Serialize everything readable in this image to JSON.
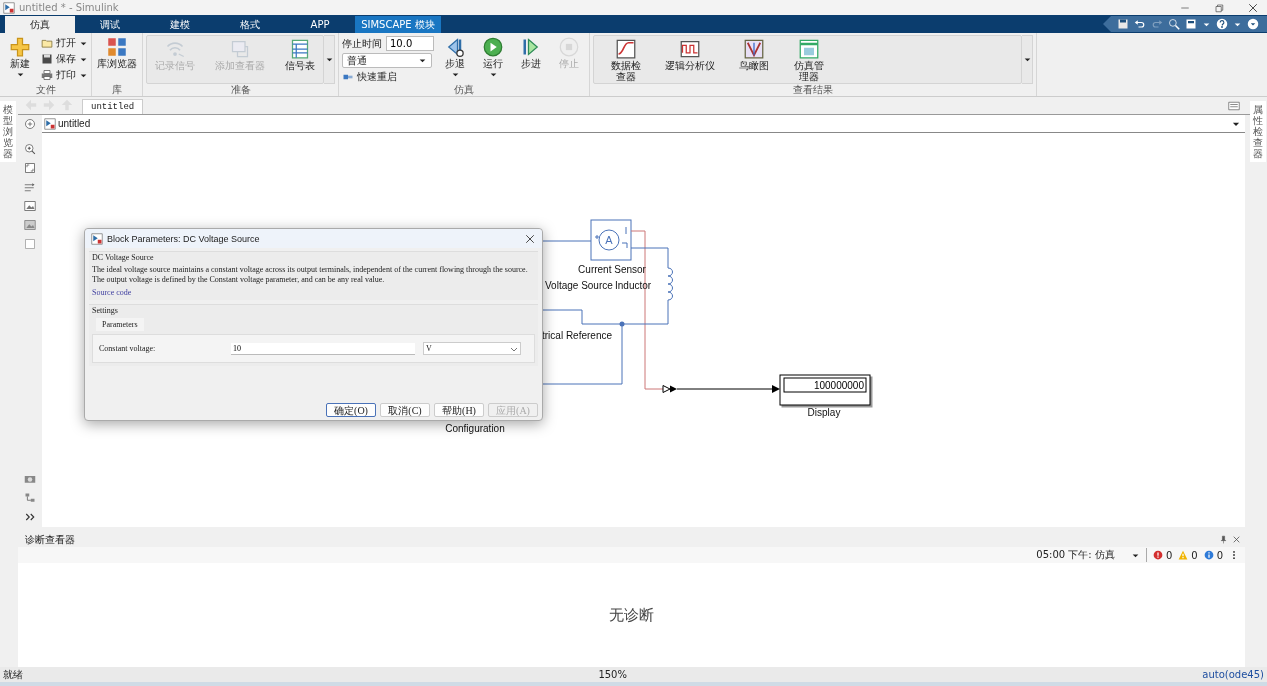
{
  "window": {
    "title": "untitled * - Simulink"
  },
  "tabs": [
    {
      "label": "仿真",
      "selected": true,
      "kind": "standard"
    },
    {
      "label": "调试",
      "selected": false,
      "kind": "standard"
    },
    {
      "label": "建模",
      "selected": false,
      "kind": "standard"
    },
    {
      "label": "格式",
      "selected": false,
      "kind": "standard"
    },
    {
      "label": "APP",
      "selected": false,
      "kind": "standard"
    },
    {
      "label": "SIMSCAPE 模块",
      "selected": false,
      "kind": "contextual"
    }
  ],
  "ribbon": {
    "groups": [
      {
        "label": "文件",
        "gallery": false,
        "items": [
          {
            "kind": "large",
            "label": "新建",
            "menu": true,
            "disabled": false
          },
          {
            "kind": "small",
            "label": "打开",
            "menu": true,
            "disabled": false
          },
          {
            "kind": "small",
            "label": "保存",
            "menu": true,
            "disabled": false
          },
          {
            "kind": "small",
            "label": "打印",
            "menu": true,
            "disabled": false
          }
        ]
      },
      {
        "label": "库",
        "gallery": false,
        "items": [
          {
            "kind": "large",
            "label": "库浏览器",
            "menu": false,
            "disabled": false
          }
        ]
      },
      {
        "label": "准备",
        "gallery": true,
        "items": [
          {
            "kind": "large",
            "label": "记录信号",
            "menu": false,
            "disabled": true
          },
          {
            "kind": "large",
            "label": "添加查看器",
            "menu": false,
            "disabled": true
          },
          {
            "kind": "large",
            "label": "信号表",
            "menu": false,
            "disabled": false
          }
        ]
      },
      {
        "label": "仿真",
        "gallery": false,
        "items": [
          {
            "kind": "field",
            "label": "停止时间",
            "value": "10.0"
          },
          {
            "kind": "select",
            "value": "普通"
          },
          {
            "kind": "toggle",
            "label": "快速重启",
            "disabled": false
          },
          {
            "kind": "large",
            "label": "步退",
            "menu": true,
            "disabled": false
          },
          {
            "kind": "large",
            "label": "运行",
            "menu": true,
            "disabled": false
          },
          {
            "kind": "large",
            "label": "步进",
            "menu": false,
            "disabled": false
          },
          {
            "kind": "large",
            "label": "停止",
            "menu": false,
            "disabled": true
          }
        ]
      },
      {
        "label": "查看结果",
        "gallery": true,
        "items": [
          {
            "kind": "large",
            "label": "数据检查器",
            "menu": false,
            "disabled": false
          },
          {
            "kind": "large",
            "label": "逻辑分析仪",
            "menu": false,
            "disabled": false
          },
          {
            "kind": "large",
            "label": "鸟瞰图",
            "menu": false,
            "disabled": false
          },
          {
            "kind": "large",
            "label": "仿真管理器",
            "menu": false,
            "disabled": false
          }
        ]
      }
    ]
  },
  "side_panels": {
    "left": "模型浏览器",
    "right": "属性检查器"
  },
  "editor_tab": {
    "label": "untitled",
    "selected": true
  },
  "breadcrumb": "untitled",
  "canvas": {
    "labels": [
      "Current Sensor",
      "Voltage Source",
      "Inductor",
      "trical Reference",
      "Display",
      "Configuration"
    ],
    "sensor_symbol": "A",
    "display_value": "100000000"
  },
  "dialog": {
    "title": "Block Parameters: DC Voltage Source",
    "block_name": "DC Voltage Source",
    "description": "The ideal voltage source maintains a constant voltage across its output terminals, independent of the current flowing through the source. The output voltage is defined by the Constant voltage parameter, and can be any real value.",
    "link": "Source code",
    "settings_label": "Settings",
    "tabs": [
      {
        "label": "Parameters",
        "selected": true
      }
    ],
    "parameter": {
      "label": "Constant voltage:",
      "value": "10",
      "unit": "V"
    },
    "buttons": [
      {
        "label": "确定(O)",
        "default": true,
        "disabled": false
      },
      {
        "label": "取消(C)",
        "default": false,
        "disabled": false
      },
      {
        "label": "帮助(H)",
        "default": false,
        "disabled": false
      },
      {
        "label": "应用(A)",
        "default": false,
        "disabled": true
      }
    ]
  },
  "diagnostics": {
    "title": "诊断查看器",
    "filter": "05:00 下午: 仿真",
    "counts": [
      {
        "kind": "error",
        "value": "0"
      },
      {
        "kind": "warning",
        "value": "0"
      },
      {
        "kind": "info",
        "value": "0"
      }
    ],
    "message": "无诊断"
  },
  "status_bar": {
    "left": "就绪",
    "center": "150%",
    "right": "auto(ode45)"
  }
}
